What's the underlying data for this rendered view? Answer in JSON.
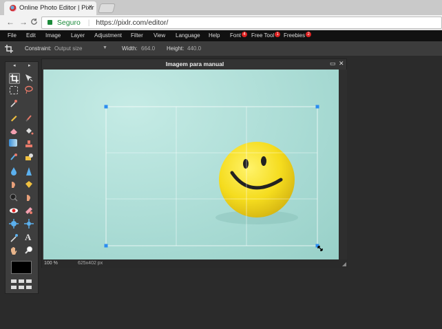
{
  "browser": {
    "tab_title": "Online Photo Editor | Pixlr",
    "tab_close": "×",
    "back": "←",
    "forward": "→",
    "reload": "C",
    "secure_label": "Seguro",
    "url": "https://pixlr.com/editor/"
  },
  "menu": {
    "items": [
      {
        "label": "File"
      },
      {
        "label": "Edit"
      },
      {
        "label": "Image"
      },
      {
        "label": "Layer"
      },
      {
        "label": "Adjustment"
      },
      {
        "label": "Filter"
      },
      {
        "label": "View"
      },
      {
        "label": "Language"
      },
      {
        "label": "Help"
      },
      {
        "label": "Font",
        "badge": "4"
      },
      {
        "label": "Free Tool",
        "badge": "1"
      },
      {
        "label": "Freebies",
        "badge": "2"
      }
    ]
  },
  "options": {
    "constraint_label": "Constraint:",
    "constraint_value": "Output size",
    "width_label": "Width:",
    "width_value": "664.0",
    "height_label": "Height:",
    "height_value": "440.0"
  },
  "toolbox": {
    "left_arrow": "◂",
    "right_arrow": "▸",
    "text_tool": "A",
    "foreground_color": "#000000"
  },
  "document": {
    "title": "Imagem para manual",
    "restore": "▭",
    "close": "✕",
    "zoom": "100",
    "zoom_unit": "%",
    "size": "625x402 px"
  },
  "colors": {
    "canvas_bg": "#a9dbd4",
    "smiley": "#f5dc1e",
    "crop_handle": "#2a8cf0"
  }
}
